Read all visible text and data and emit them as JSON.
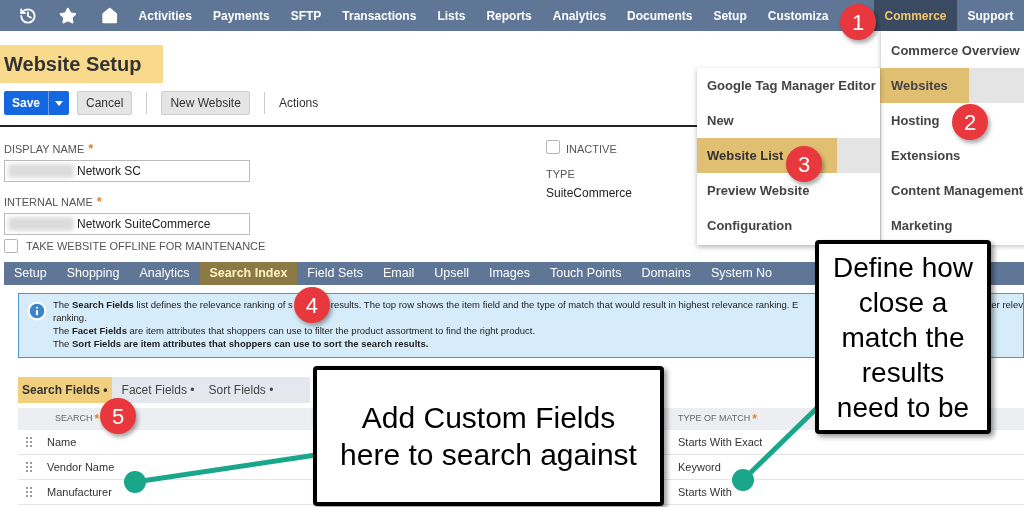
{
  "nav": {
    "items": [
      {
        "label": "Activities",
        "selected": false
      },
      {
        "label": "Payments",
        "selected": false
      },
      {
        "label": "SFTP",
        "selected": false
      },
      {
        "label": "Transactions",
        "selected": false
      },
      {
        "label": "Lists",
        "selected": false
      },
      {
        "label": "Reports",
        "selected": false
      },
      {
        "label": "Analytics",
        "selected": false
      },
      {
        "label": "Documents",
        "selected": false
      },
      {
        "label": "Setup",
        "selected": false
      },
      {
        "label": "Customiza",
        "selected": false
      },
      {
        "label": "Commerce",
        "selected": true
      },
      {
        "label": "Support",
        "selected": false
      }
    ]
  },
  "page_title": "Website Setup",
  "toolbar": {
    "buttons": [
      {
        "label": "Save",
        "kind": "primary"
      },
      {
        "label": "Cancel",
        "kind": "secondary"
      },
      {
        "label": "New Website",
        "kind": "secondary"
      },
      {
        "label": "Actions",
        "kind": "plain"
      }
    ]
  },
  "form": {
    "display_name": {
      "label": "DISPLAY NAME",
      "required_mark": "*",
      "value": "Network SC"
    },
    "internal_name": {
      "label": "INTERNAL NAME",
      "required_mark": "*",
      "value": "Network SuiteCommerce"
    },
    "offline": {
      "label": "TAKE WEBSITE OFFLINE FOR MAINTENANCE",
      "checked": false
    },
    "inactive": {
      "label": "INACTIVE",
      "checked": false
    },
    "type": {
      "label": "TYPE",
      "value": "SuiteCommerce"
    }
  },
  "tabs": [
    {
      "label": "Setup",
      "selected": false
    },
    {
      "label": "Shopping",
      "selected": false
    },
    {
      "label": "Analytics",
      "selected": false
    },
    {
      "label": "Search Index",
      "selected": true
    },
    {
      "label": "Field Sets",
      "selected": false
    },
    {
      "label": "Email",
      "selected": false
    },
    {
      "label": "Upsell",
      "selected": false
    },
    {
      "label": "Images",
      "selected": false
    },
    {
      "label": "Touch Points",
      "selected": false
    },
    {
      "label": "Domains",
      "selected": false
    },
    {
      "label": "System No",
      "selected": false
    }
  ],
  "info_banner": {
    "lines": [
      {
        "parts": [
          "The **Search Fields** list defines the relevance ranking of s",
          "results. The top row shows the item field and the type of match that would result in highest relevance ranking. E"
        ],
        "tail": "er relev"
      },
      {
        "text": "ranking."
      },
      {
        "text": "The **Facet Fields** are item attributes that shoppers can use to filter the product assortment to find the right product."
      },
      {
        "text": "The **Sort Fields are item attributes that shoppers can use to sort the search results.**"
      }
    ]
  },
  "subtabs": [
    {
      "label": "Search Fields •",
      "selected": true
    },
    {
      "label": "Facet Fields •",
      "selected": false
    },
    {
      "label": "Sort Fields •",
      "selected": false
    }
  ],
  "table": {
    "columns": [
      {
        "label": "SEARCH",
        "required_mark": "*"
      },
      {
        "label": "TYPE OF MATCH",
        "required_mark": "*"
      }
    ],
    "rows": [
      [
        "Name",
        "Starts With Exact"
      ],
      [
        "Vendor Name",
        "Keyword"
      ],
      [
        "Manufacturer",
        "Starts With"
      ]
    ]
  },
  "menus": {
    "commerce": [
      {
        "label": "Commerce Overview",
        "selected": false
      },
      {
        "label": "Websites",
        "selected": true
      },
      {
        "label": "Hosting",
        "selected": false
      },
      {
        "label": "Extensions",
        "selected": false
      },
      {
        "label": "Content Management",
        "selected": false
      },
      {
        "label": "Marketing",
        "selected": false
      }
    ],
    "websites": [
      {
        "label": "Google Tag Manager Editor",
        "selected": false
      },
      {
        "label": "New",
        "selected": false
      },
      {
        "label": "Website List",
        "selected": true
      },
      {
        "label": "Preview Website",
        "selected": false
      },
      {
        "label": "Configuration",
        "selected": false
      }
    ]
  },
  "badges": [
    "1",
    "2",
    "3",
    "4",
    "5"
  ],
  "callouts": [
    "Add Custom Fields here to search against",
    "Define how close a match the results need to be"
  ]
}
